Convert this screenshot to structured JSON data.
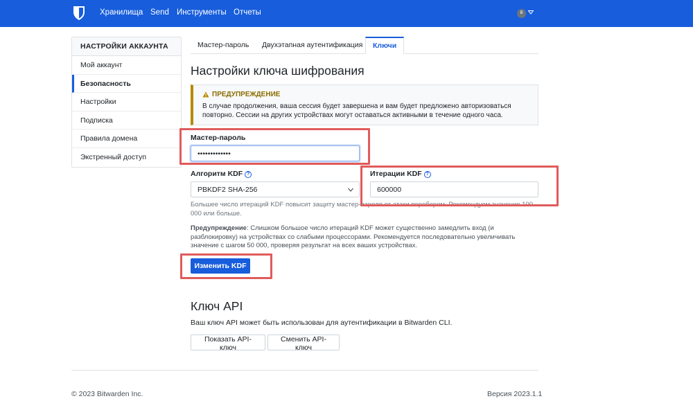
{
  "nav": {
    "items": [
      "Хранилища",
      "Send",
      "Инструменты",
      "Отчеты"
    ],
    "avatar_initials": "B"
  },
  "sidebar": {
    "header": "НАСТРОЙКИ АККАУНТА",
    "items": [
      "Мой аккаунт",
      "Безопасность",
      "Настройки",
      "Подписка",
      "Правила домена",
      "Экстренный доступ"
    ],
    "active_index": 1
  },
  "tabs": {
    "items": [
      "Мастер-пароль",
      "Двухэтапная аутентификация",
      "Ключи"
    ],
    "active_index": 2
  },
  "encryption": {
    "title": "Настройки ключа шифрования",
    "warning_title": "ПРЕДУПРЕЖДЕНИЕ",
    "warning_body": "В случае продолжения, ваша сессия будет завершена и вам будет предложено авторизоваться повторно. Сессии на других устройствах могут оставаться активными в течение одного часа.",
    "master_password_label": "Мастер-пароль",
    "master_password_value": "•••••••••••••",
    "kdf_algorithm_label": "Алгоритм KDF",
    "kdf_algorithm_value": "PBKDF2 SHA-256",
    "kdf_iterations_label": "Итерации KDF",
    "kdf_iterations_value": "600000",
    "iterations_hint": "Большее число итераций KDF повысит защиту мастер-пароля от атаки перебором. Рекомендуем значение 100 000 или больше.",
    "warning2_prefix": "Предупреждение",
    "warning2_text": ": Слишком большое число итераций KDF может существенно замедлить вход (и разблокировку) на устройствах со слабыми процессорами. Рекомендуется последовательно увеличивать значение с шагом 50 000, проверяя результат на всех ваших устройствах.",
    "change_kdf_button": "Изменить KDF"
  },
  "api": {
    "title": "Ключ API",
    "description": "Ваш ключ API может быть использован для аутентификации в Bitwarden CLI.",
    "show_button": "Показать API-ключ",
    "rotate_button": "Сменить API-ключ"
  },
  "footer": {
    "copyright": "© 2023 Bitwarden Inc.",
    "version": "Версия 2023.1.1"
  },
  "colors": {
    "brand": "#175ddc",
    "highlight": "#e05b5b",
    "warning": "#b58a00"
  },
  "icons": {
    "logo": "bitwarden-shield-icon",
    "help": "question-circle-icon",
    "warning": "warning-triangle-icon",
    "caret": "chevron-down-icon"
  }
}
